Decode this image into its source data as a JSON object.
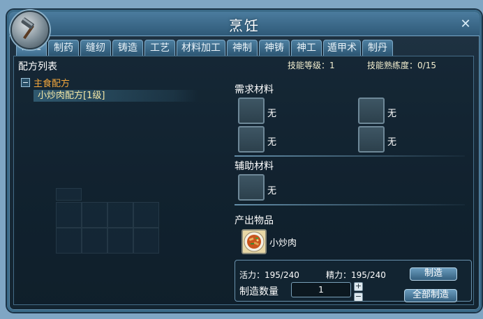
{
  "window": {
    "title": "烹饪"
  },
  "tabs": [
    "烹饪",
    "制药",
    "缝纫",
    "铸造",
    "工艺",
    "材料加工",
    "神制",
    "神铸",
    "神工",
    "遁甲术",
    "制丹"
  ],
  "recipe_list": {
    "title": "配方列表",
    "category": "主食配方",
    "items": [
      "小炒肉配方[1级]"
    ]
  },
  "skill": {
    "level_text": "技能等级：1",
    "proficiency_text": "技能熟练度：0/15"
  },
  "required": {
    "title": "需求材料",
    "slots": [
      "无",
      "无",
      "无",
      "无"
    ]
  },
  "auxiliary": {
    "title": "辅助材料",
    "slots": [
      "无"
    ]
  },
  "output": {
    "title": "产出物品",
    "item": "小炒肉"
  },
  "craft": {
    "vitality_text": "活力：195/240",
    "energy_text": "精力：195/240",
    "quantity_label": "制造数量",
    "quantity_value": "1",
    "make_button": "制造",
    "make_all_button": "全部制造"
  }
}
